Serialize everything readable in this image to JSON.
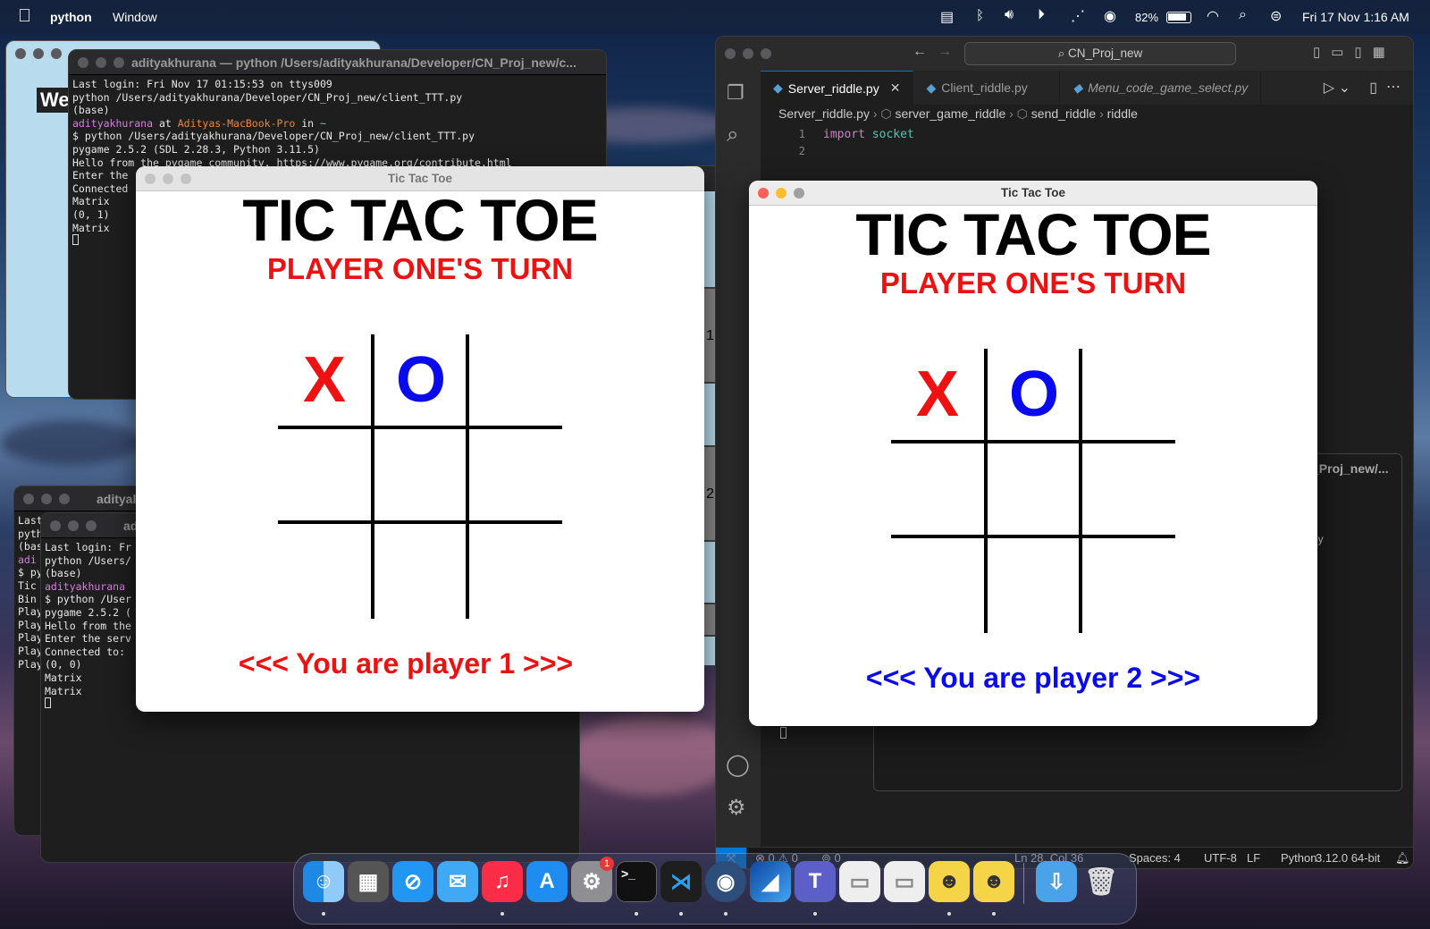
{
  "menubar": {
    "app": "python",
    "window_menu": "Window",
    "battery": "82%",
    "datetime": "Fri 17 Nov  1:16 AM"
  },
  "term1": {
    "title": "adityakhurana — python /Users/adityakhurana/Developer/CN_Proj_new/c...",
    "l1": "Last login: Fri Nov 17 01:15:53 on ttys009",
    "l2": "python /Users/adityakhurana/Developer/CN_Proj_new/client_TTT.py",
    "l3": "(base)",
    "user": "adityakhurana",
    "at": " at ",
    "host": "Adityas-MacBook-Pro",
    "in": " in ",
    "tilde": "~",
    "l5": "$ python /Users/adityakhurana/Developer/CN_Proj_new/client_TTT.py",
    "l6": "pygame 2.5.2 (SDL 2.28.3, Python 3.11.5)",
    "l7": "Hello from the pygame community. https://www.pygame.org/contribute.html",
    "l8": "Enter the",
    "l9": "Connected",
    "l10": "Matrix",
    "l11": "(0, 1)",
    "l12": "Matrix"
  },
  "bg_window": {
    "partial_text": "We"
  },
  "term2": {
    "title": "adityal",
    "lines": [
      "Last",
      "pyth",
      "(bas",
      "adi",
      "$ py",
      "Tic",
      "Bin",
      "Play",
      "Play",
      "Play",
      "Play",
      "Play"
    ]
  },
  "term3": {
    "title": "ad",
    "l1": "Last login: Fr",
    "l2": "python /Users/",
    "l3": "(base)",
    "l4": "adityakhurana",
    "l5": "$ python /User",
    "l6": "pygame 2.5.2 (",
    "l7": "Hello from the",
    "l8": "Enter the serv",
    "l9": "Connected to:",
    "l10": "(0, 0)",
    "l11": "Matrix",
    "l12": "Matrix"
  },
  "game1": {
    "window_title": "Tic Tac Toe",
    "heading": "TIC TAC TOE",
    "turn": "PLAYER ONE'S TURN",
    "cell_00": "X",
    "cell_01": "O",
    "footer": "<<< You are player 1 >>>"
  },
  "game2": {
    "window_title": "Tic Tac Toe",
    "heading": "TIC TAC TOE",
    "turn": "PLAYER ONE'S TURN",
    "cell_00": "X",
    "cell_01": "O",
    "footer": "<<< You are player 2 >>>"
  },
  "mid_window": {
    "n1": "1",
    "n2": "2"
  },
  "vscode": {
    "search": "CN_Proj_new",
    "tabs": [
      "Server_riddle.py",
      "Client_riddle.py",
      "Menu_code_game_select.py"
    ],
    "crumb": [
      "Server_riddle.py",
      "server_game_riddle",
      "send_riddle",
      "riddle"
    ],
    "ln1": "1",
    "ln2": "2",
    "kw": "import",
    "mod": "socket",
    "panel_title": "_Proj_new/...",
    "panel_frag": "py",
    "panel_ln": "8",
    "status": {
      "problems": "⊗ 0 ⚠ 0",
      "ports": "⊚ 0",
      "pos": "Ln 28, Col 36",
      "spaces": "Spaces: 4",
      "enc": "UTF-8",
      "eol": "LF",
      "lang": "Python",
      "ver": "3.12.0 64-bit"
    }
  },
  "dock": {
    "badge": "1"
  }
}
